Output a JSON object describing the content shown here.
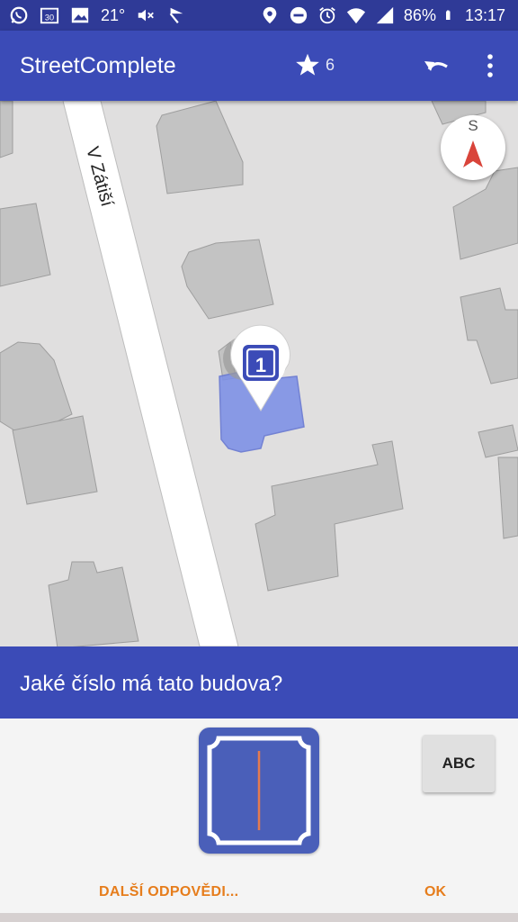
{
  "status_bar": {
    "temperature": "21°",
    "battery": "86%",
    "time": "13:17",
    "icons_left": [
      "whatsapp-icon",
      "calendar-icon",
      "image-icon",
      "mute-icon",
      "flag-icon"
    ],
    "icons_right": [
      "location-icon",
      "dnd-icon",
      "alarm-icon",
      "wifi-icon",
      "signal-icon",
      "battery-icon"
    ]
  },
  "toolbar": {
    "title": "StreetComplete",
    "star_count": "6",
    "colors": {
      "primary": "#3b4bb7",
      "primary_dark": "#2f3a97"
    }
  },
  "map": {
    "street_name": "V Zátiší",
    "compass_label": "S",
    "marker_number": "1",
    "highlight_color": "#7f92e6"
  },
  "quest": {
    "question": "Jaké číslo má tato budova?",
    "abc_label": "ABC",
    "other_answers_label": "DALŠÍ ODPOVĚDI...",
    "ok_label": "OK",
    "accent_color": "#e67d1c"
  }
}
